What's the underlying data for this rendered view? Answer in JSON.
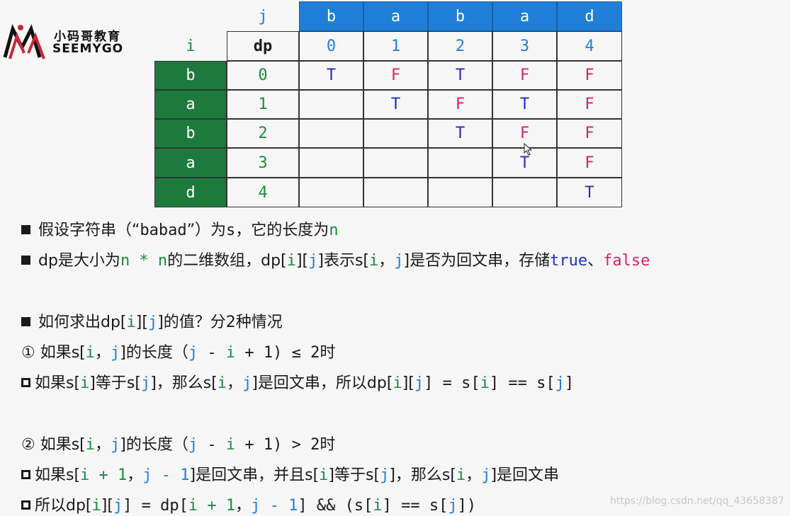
{
  "logo": {
    "cn": "小码哥教育",
    "en": "SEEMYGO"
  },
  "table": {
    "j_label": "j",
    "i_label": "i",
    "dp_label": "dp",
    "col_chars": [
      "b",
      "a",
      "b",
      "a",
      "d"
    ],
    "col_idx": [
      "0",
      "1",
      "2",
      "3",
      "4"
    ],
    "row_chars": [
      "b",
      "a",
      "b",
      "a",
      "d"
    ],
    "row_idx": [
      "0",
      "1",
      "2",
      "3",
      "4"
    ],
    "values": [
      [
        "T",
        "F",
        "T",
        "F",
        "F"
      ],
      [
        "",
        "T",
        "F",
        "T",
        "F"
      ],
      [
        "",
        "",
        "T",
        "F",
        "F"
      ],
      [
        "",
        "",
        "",
        "T",
        "F"
      ],
      [
        "",
        "",
        "",
        "",
        "T"
      ]
    ],
    "true_color": "#1f2fb8",
    "false_color": "#d0256a"
  },
  "lines": [
    [
      [
        "k",
        "假设字符串（“"
      ],
      [
        "m",
        "babad"
      ],
      [
        "k",
        "”）为"
      ],
      [
        "m",
        "s"
      ],
      [
        "k",
        "，它的长度为"
      ],
      [
        "mg",
        "n"
      ]
    ],
    [
      [
        "k",
        "dp是大小为"
      ],
      [
        "mg",
        "n * n"
      ],
      [
        "k",
        "的二维数组，dp["
      ],
      [
        "mg",
        "i"
      ],
      [
        "k",
        "]["
      ],
      [
        "mb",
        "j"
      ],
      [
        "k",
        "]表示s["
      ],
      [
        "mg",
        "i"
      ],
      [
        "k",
        "，"
      ],
      [
        "mb",
        "j"
      ],
      [
        "k",
        "]是否为回文串，存储"
      ],
      [
        "md",
        "true"
      ],
      [
        "k",
        "、"
      ],
      [
        "mr",
        "false"
      ]
    ],
    [
      [
        "k",
        "如何求出dp["
      ],
      [
        "mg",
        "i"
      ],
      [
        "k",
        "]["
      ],
      [
        "mb",
        "j"
      ],
      [
        "k",
        "]的值？分2种情况"
      ]
    ],
    [
      [
        "k",
        "① 如果s["
      ],
      [
        "mg",
        "i"
      ],
      [
        "k",
        "，"
      ],
      [
        "mb",
        "j"
      ],
      [
        "k",
        "]的长度（"
      ],
      [
        "mb",
        "j"
      ],
      [
        "m",
        " - "
      ],
      [
        "mg",
        "i"
      ],
      [
        "m",
        " + 1) ≤ 2"
      ],
      [
        "k",
        "时"
      ]
    ],
    [
      [
        "k",
        "如果s["
      ],
      [
        "mg",
        "i"
      ],
      [
        "k",
        "]等于s["
      ],
      [
        "mb",
        "j"
      ],
      [
        "k",
        "]，那么s["
      ],
      [
        "mg",
        "i"
      ],
      [
        "k",
        "，"
      ],
      [
        "mb",
        "j"
      ],
      [
        "k",
        "]是回文串，所以dp["
      ],
      [
        "mg",
        "i"
      ],
      [
        "k",
        "]["
      ],
      [
        "mb",
        "j"
      ],
      [
        "m",
        "] = s["
      ],
      [
        "mg",
        "i"
      ],
      [
        "m",
        "] == s["
      ],
      [
        "mb",
        "j"
      ],
      [
        "m",
        "]"
      ]
    ],
    [
      [
        "k",
        "② 如果s["
      ],
      [
        "mg",
        "i"
      ],
      [
        "k",
        "，"
      ],
      [
        "mb",
        "j"
      ],
      [
        "k",
        "]的长度（"
      ],
      [
        "mb",
        "j"
      ],
      [
        "m",
        " - "
      ],
      [
        "mg",
        "i"
      ],
      [
        "m",
        " + 1) > 2"
      ],
      [
        "k",
        "时"
      ]
    ],
    [
      [
        "k",
        "如果s["
      ],
      [
        "mg",
        "i + 1"
      ],
      [
        "k",
        "，"
      ],
      [
        "mb",
        "j - 1"
      ],
      [
        "k",
        "]是回文串，并且s["
      ],
      [
        "mg",
        "i"
      ],
      [
        "k",
        "]等于s["
      ],
      [
        "mb",
        "j"
      ],
      [
        "k",
        "]，那么s["
      ],
      [
        "mg",
        "i"
      ],
      [
        "k",
        "，"
      ],
      [
        "mb",
        "j"
      ],
      [
        "k",
        "]是回文串"
      ]
    ],
    [
      [
        "k",
        "所以dp["
      ],
      [
        "mg",
        "i"
      ],
      [
        "k",
        "]["
      ],
      [
        "mb",
        "j"
      ],
      [
        "m",
        "] = dp["
      ],
      [
        "mg",
        "i + 1"
      ],
      [
        "k",
        "，"
      ],
      [
        "mb",
        "j - 1"
      ],
      [
        "m",
        "] && (s["
      ],
      [
        "mg",
        "i"
      ],
      [
        "m",
        "] == s["
      ],
      [
        "mb",
        "j"
      ],
      [
        "m",
        "])"
      ]
    ]
  ],
  "watermark": "https://blog.csdn.net/qq_43658387"
}
